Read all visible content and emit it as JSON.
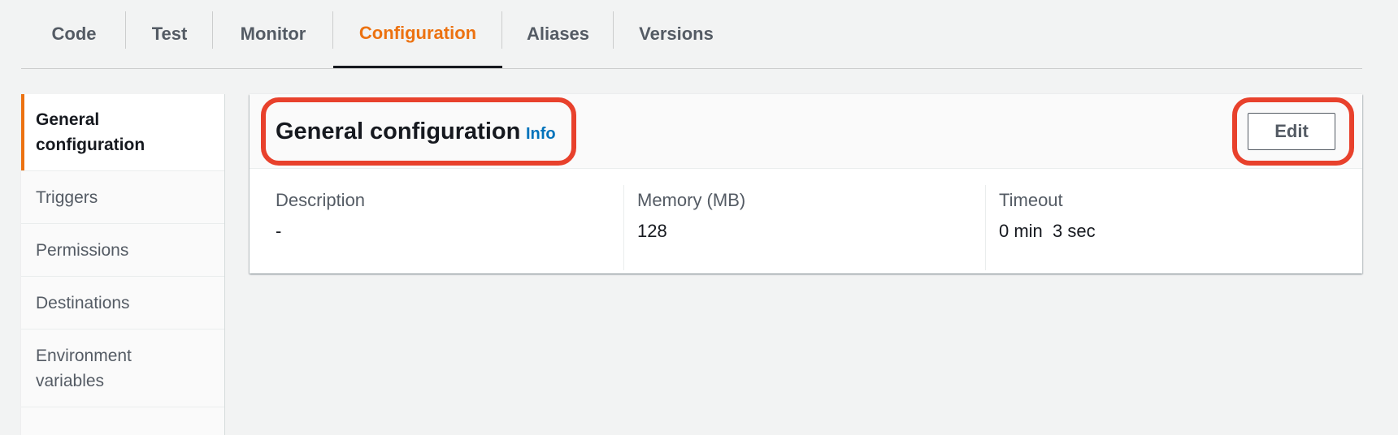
{
  "tabs": [
    {
      "label": "Code",
      "active": false
    },
    {
      "label": "Test",
      "active": false
    },
    {
      "label": "Monitor",
      "active": false
    },
    {
      "label": "Configuration",
      "active": true
    },
    {
      "label": "Aliases",
      "active": false
    },
    {
      "label": "Versions",
      "active": false
    }
  ],
  "sidenav": {
    "items": [
      {
        "line1": "General",
        "line2": "configuration",
        "active": true
      },
      {
        "line1": "Triggers",
        "line2": "",
        "active": false
      },
      {
        "line1": "Permissions",
        "line2": "",
        "active": false
      },
      {
        "line1": "Destinations",
        "line2": "",
        "active": false
      },
      {
        "line1": "Environment",
        "line2": "variables",
        "active": false
      }
    ]
  },
  "panel": {
    "title": "General configuration",
    "info_label": "Info",
    "edit_label": "Edit",
    "fields": [
      {
        "label": "Description",
        "value": "-"
      },
      {
        "label": "Memory (MB)",
        "value": "128"
      },
      {
        "label": "Timeout",
        "value": "0 min  3 sec"
      }
    ]
  },
  "colors": {
    "accent": "#ec7211",
    "link": "#0073bb",
    "highlight": "#e8412c"
  }
}
